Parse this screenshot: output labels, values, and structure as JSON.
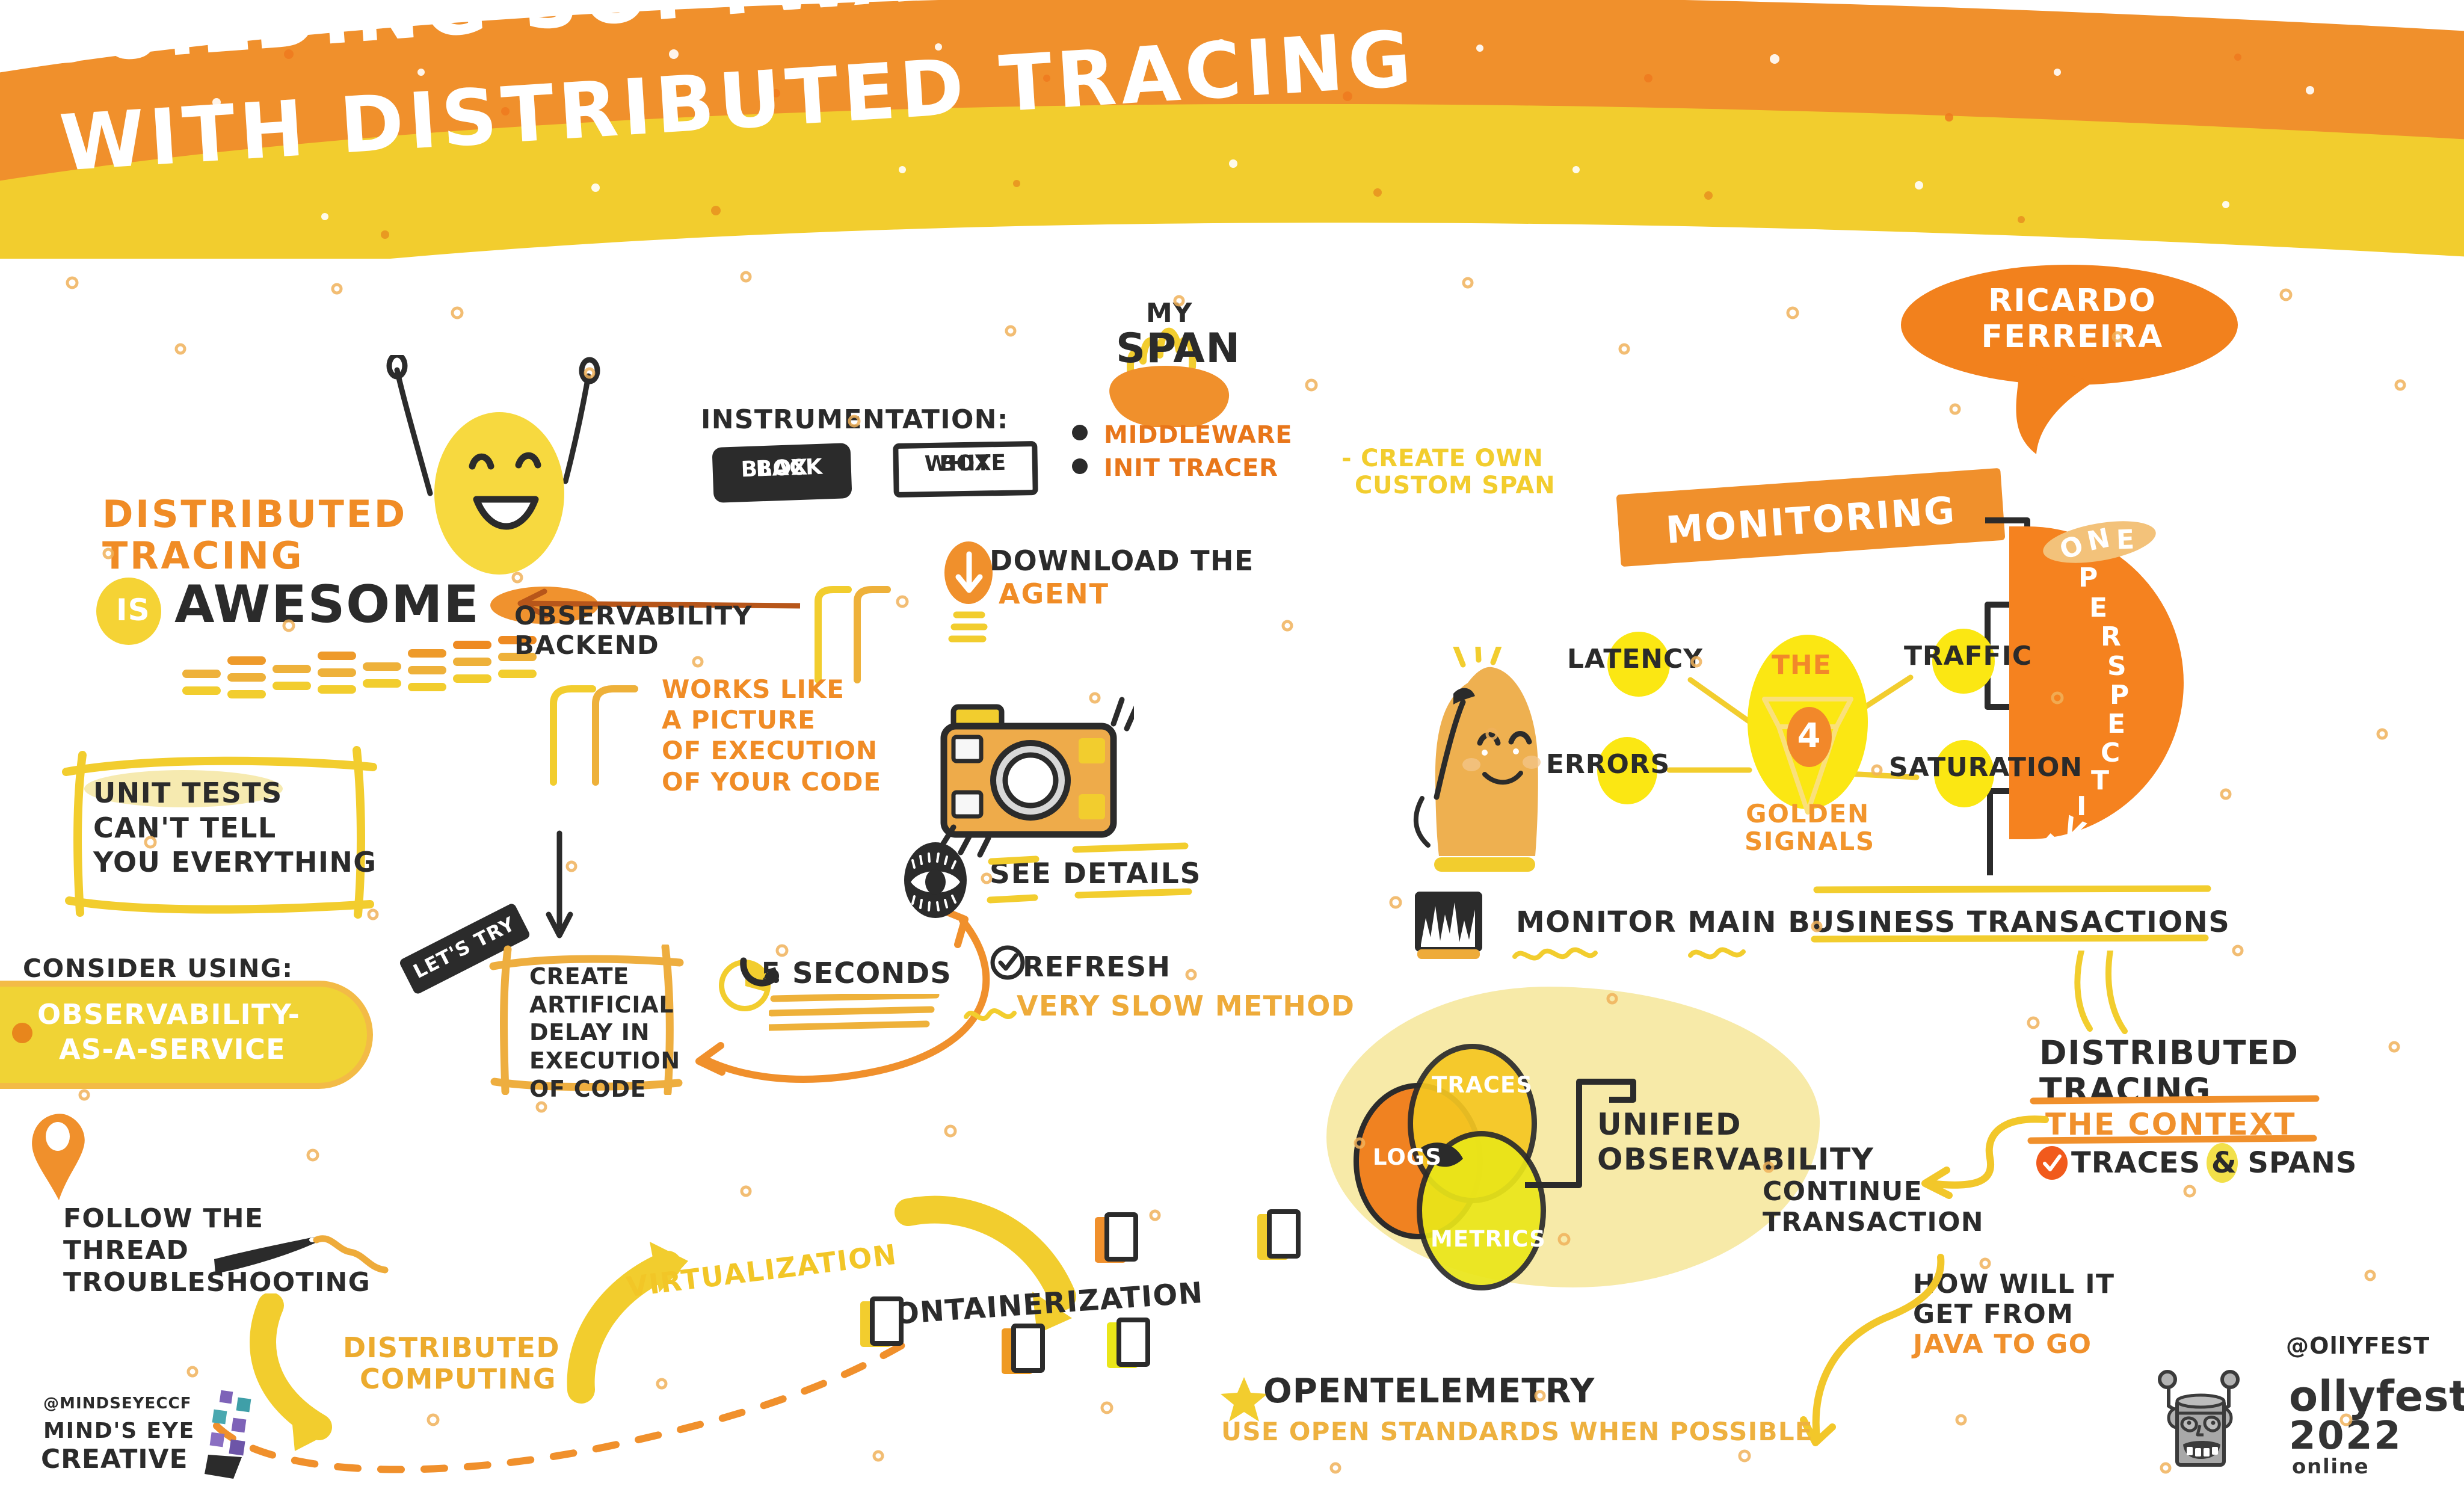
{
  "header": {
    "title_line1": "BUILDING SOFTWARE RELIABILITY",
    "title_line2": "WITH DISTRIBUTED TRACING",
    "band_top_color": "#f0902c",
    "band_bottom_color": "#f2cd2e"
  },
  "speaker": {
    "name_line1": "RICARDO",
    "name_line2": "FERREIRA"
  },
  "left": {
    "dt_line1": "DISTRIBUTED",
    "dt_line2": "TRACING",
    "is_label": "IS",
    "awesome": "AWESOME",
    "observability_backend_l1": "OBSERVABILITY",
    "observability_backend_l2": "BACKEND",
    "works_like_l1": "WORKS LIKE",
    "works_like_l2": "A PICTURE",
    "works_like_l3": "OF EXECUTION",
    "works_like_l4": "OF YOUR CODE",
    "unit_tests_l1": "UNIT TESTS",
    "unit_tests_l2": "CAN'T TELL",
    "unit_tests_l3": "YOU EVERYTHING",
    "consider_using": "CONSIDER USING:",
    "oaas_l1": "OBSERVABILITY-",
    "oaas_l2": "AS-A-SERVICE",
    "lets_try": "LET'S TRY",
    "create_delay_l1": "CREATE",
    "create_delay_l2": "ARTIFICIAL",
    "create_delay_l3": "DELAY IN",
    "create_delay_l4": "EXECUTION",
    "create_delay_l5": "OF CODE",
    "seconds": "5 SECONDS"
  },
  "instrumentation": {
    "title": "INSTRUMENTATION:",
    "black_box_l1": "BLACK",
    "black_box_l2": "BOX",
    "white_box_l1": "WHITE",
    "white_box_l2": "BOX"
  },
  "span": {
    "my": "MY",
    "span": "SPAN",
    "bullet1": "MIDDLEWARE",
    "bullet2": "INIT TRACER",
    "custom_l1": "- CREATE OWN",
    "custom_l2": "CUSTOM SPAN"
  },
  "agent": {
    "download_the": "DOWNLOAD THE",
    "agent": "AGENT"
  },
  "details": {
    "see_details": "SEE DETAILS",
    "refresh": "REFRESH",
    "very_slow": "VERY SLOW METHOD"
  },
  "monitoring": {
    "banner": "MONITORING",
    "one_perspective": "ONE PERSPECTIVE",
    "one": "ONE",
    "perspective": "PERSPECTIVE",
    "monitor_main": "MONITOR MAIN BUSINESS TRANSACTIONS"
  },
  "golden_signals": {
    "the": "THE",
    "number": "4",
    "golden_l1": "GOLDEN",
    "golden_l2": "SIGNALS",
    "signals": [
      "LATENCY",
      "TRAFFIC",
      "ERRORS",
      "SATURATION"
    ]
  },
  "venn": {
    "logs": "LOGS",
    "traces": "TRACES",
    "metrics": "METRICS",
    "unified_l1": "UNIFIED",
    "unified_l2": "OBSERVABILITY",
    "colors": {
      "logs": "#f08221",
      "traces": "#f5c722",
      "metrics": "#eae619"
    }
  },
  "context": {
    "dt_l1": "DISTRIBUTED",
    "dt_l2": "TRACING",
    "the_context": "THE CONTEXT",
    "traces_spans": "TRACES & SPANS",
    "continue_l1": "CONTINUE",
    "continue_l2": "TRANSACTION",
    "how_l1": "HOW WILL IT",
    "how_l2": "GET FROM",
    "how_l3": "JAVA TO GO"
  },
  "bottom": {
    "follow_l1": "FOLLOW THE",
    "follow_l2": "THREAD",
    "follow_l3": "TROUBLESHOOTING",
    "distributed_l1": "DISTRIBUTED",
    "distributed_l2": "COMPUTING",
    "virtualization": "VIRTUALIZATION",
    "containerization": "CONTAINERIZATION",
    "opentelemetry": "OPENTELEMETRY",
    "open_standards": "USE OPEN STANDARDS WHEN POSSIBLE"
  },
  "credits": {
    "mindseye_handle": "@MINDSEYECCF",
    "mindseye_l1": "MIND'S EYE",
    "mindseye_l2": "CREATIVE",
    "ollyfest_handle": "@OllYFEST",
    "ollyfest_name": "ollyfest",
    "ollyfest_year": "2022",
    "ollyfest_online": "online"
  }
}
